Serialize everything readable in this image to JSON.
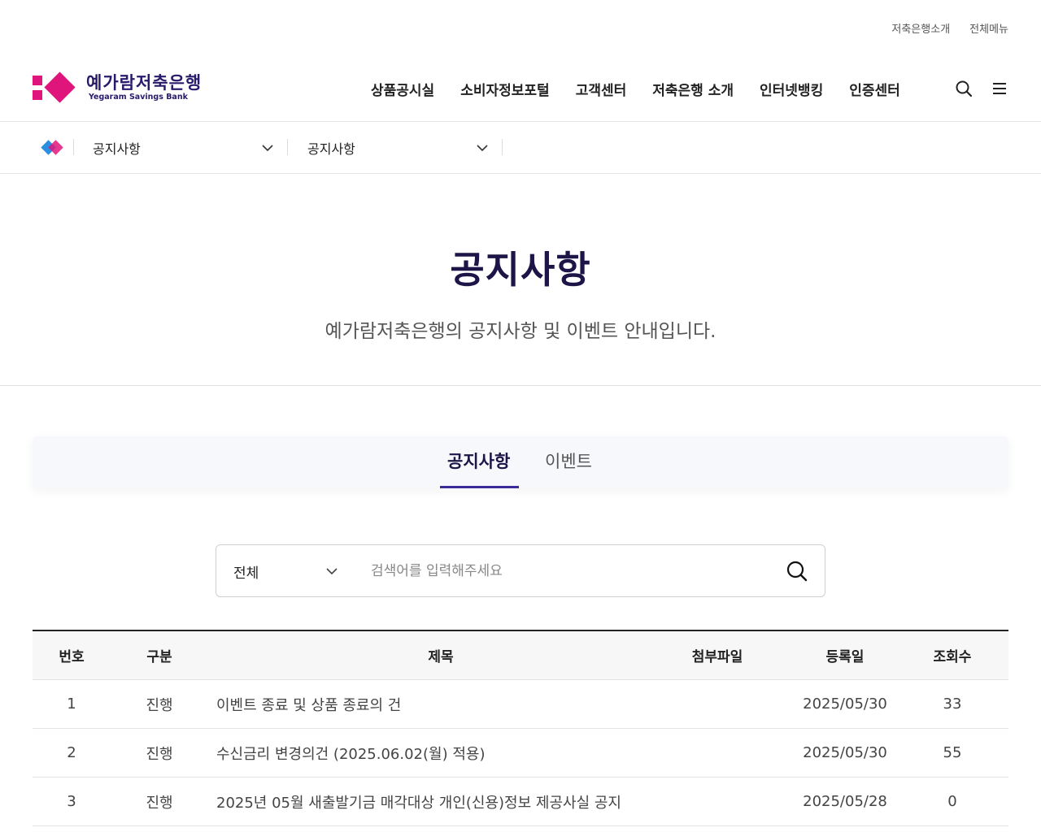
{
  "util": {
    "intro": "저축은행소개",
    "all_menu": "전체메뉴"
  },
  "logo": {
    "ko": "예가람저축은행",
    "en": "Yegaram Savings Bank"
  },
  "gnb": [
    "상품공시실",
    "소비자정보포털",
    "고객센터",
    "저축은행 소개",
    "인터넷뱅킹",
    "인증센터"
  ],
  "header_icons": [
    "search-icon",
    "menu-icon"
  ],
  "location": {
    "depth1": "공지사항",
    "depth2": "공지사항"
  },
  "page": {
    "title": "공지사항",
    "subtitle": "예가람저축은행의 공지사항 및 이벤트 안내입니다."
  },
  "tabs": [
    {
      "label": "공지사항",
      "active": true
    },
    {
      "label": "이벤트",
      "active": false
    }
  ],
  "search": {
    "category": "전체",
    "placeholder": "검색어를 입력해주세요",
    "value": ""
  },
  "table": {
    "headers": [
      "번호",
      "구분",
      "제목",
      "첨부파일",
      "등록일",
      "조회수"
    ],
    "rows": [
      {
        "no": "1",
        "cat": "진행",
        "title": "이벤트 종료 및 상품 종료의 건",
        "file": "",
        "date": "2025/05/30",
        "views": "33"
      },
      {
        "no": "2",
        "cat": "진행",
        "title": "수신금리 변경의건 (2025.06.02(월) 적용)",
        "file": "",
        "date": "2025/05/30",
        "views": "55"
      },
      {
        "no": "3",
        "cat": "진행",
        "title": "2025년 05월 새출발기금 매각대상 개인(신용)정보 제공사실 공지",
        "file": "",
        "date": "2025/05/28",
        "views": "0"
      }
    ]
  },
  "colors": {
    "brand_pink": "#e0157b",
    "brand_navy": "#1d1547",
    "tab_active": "#3b2a9a"
  }
}
